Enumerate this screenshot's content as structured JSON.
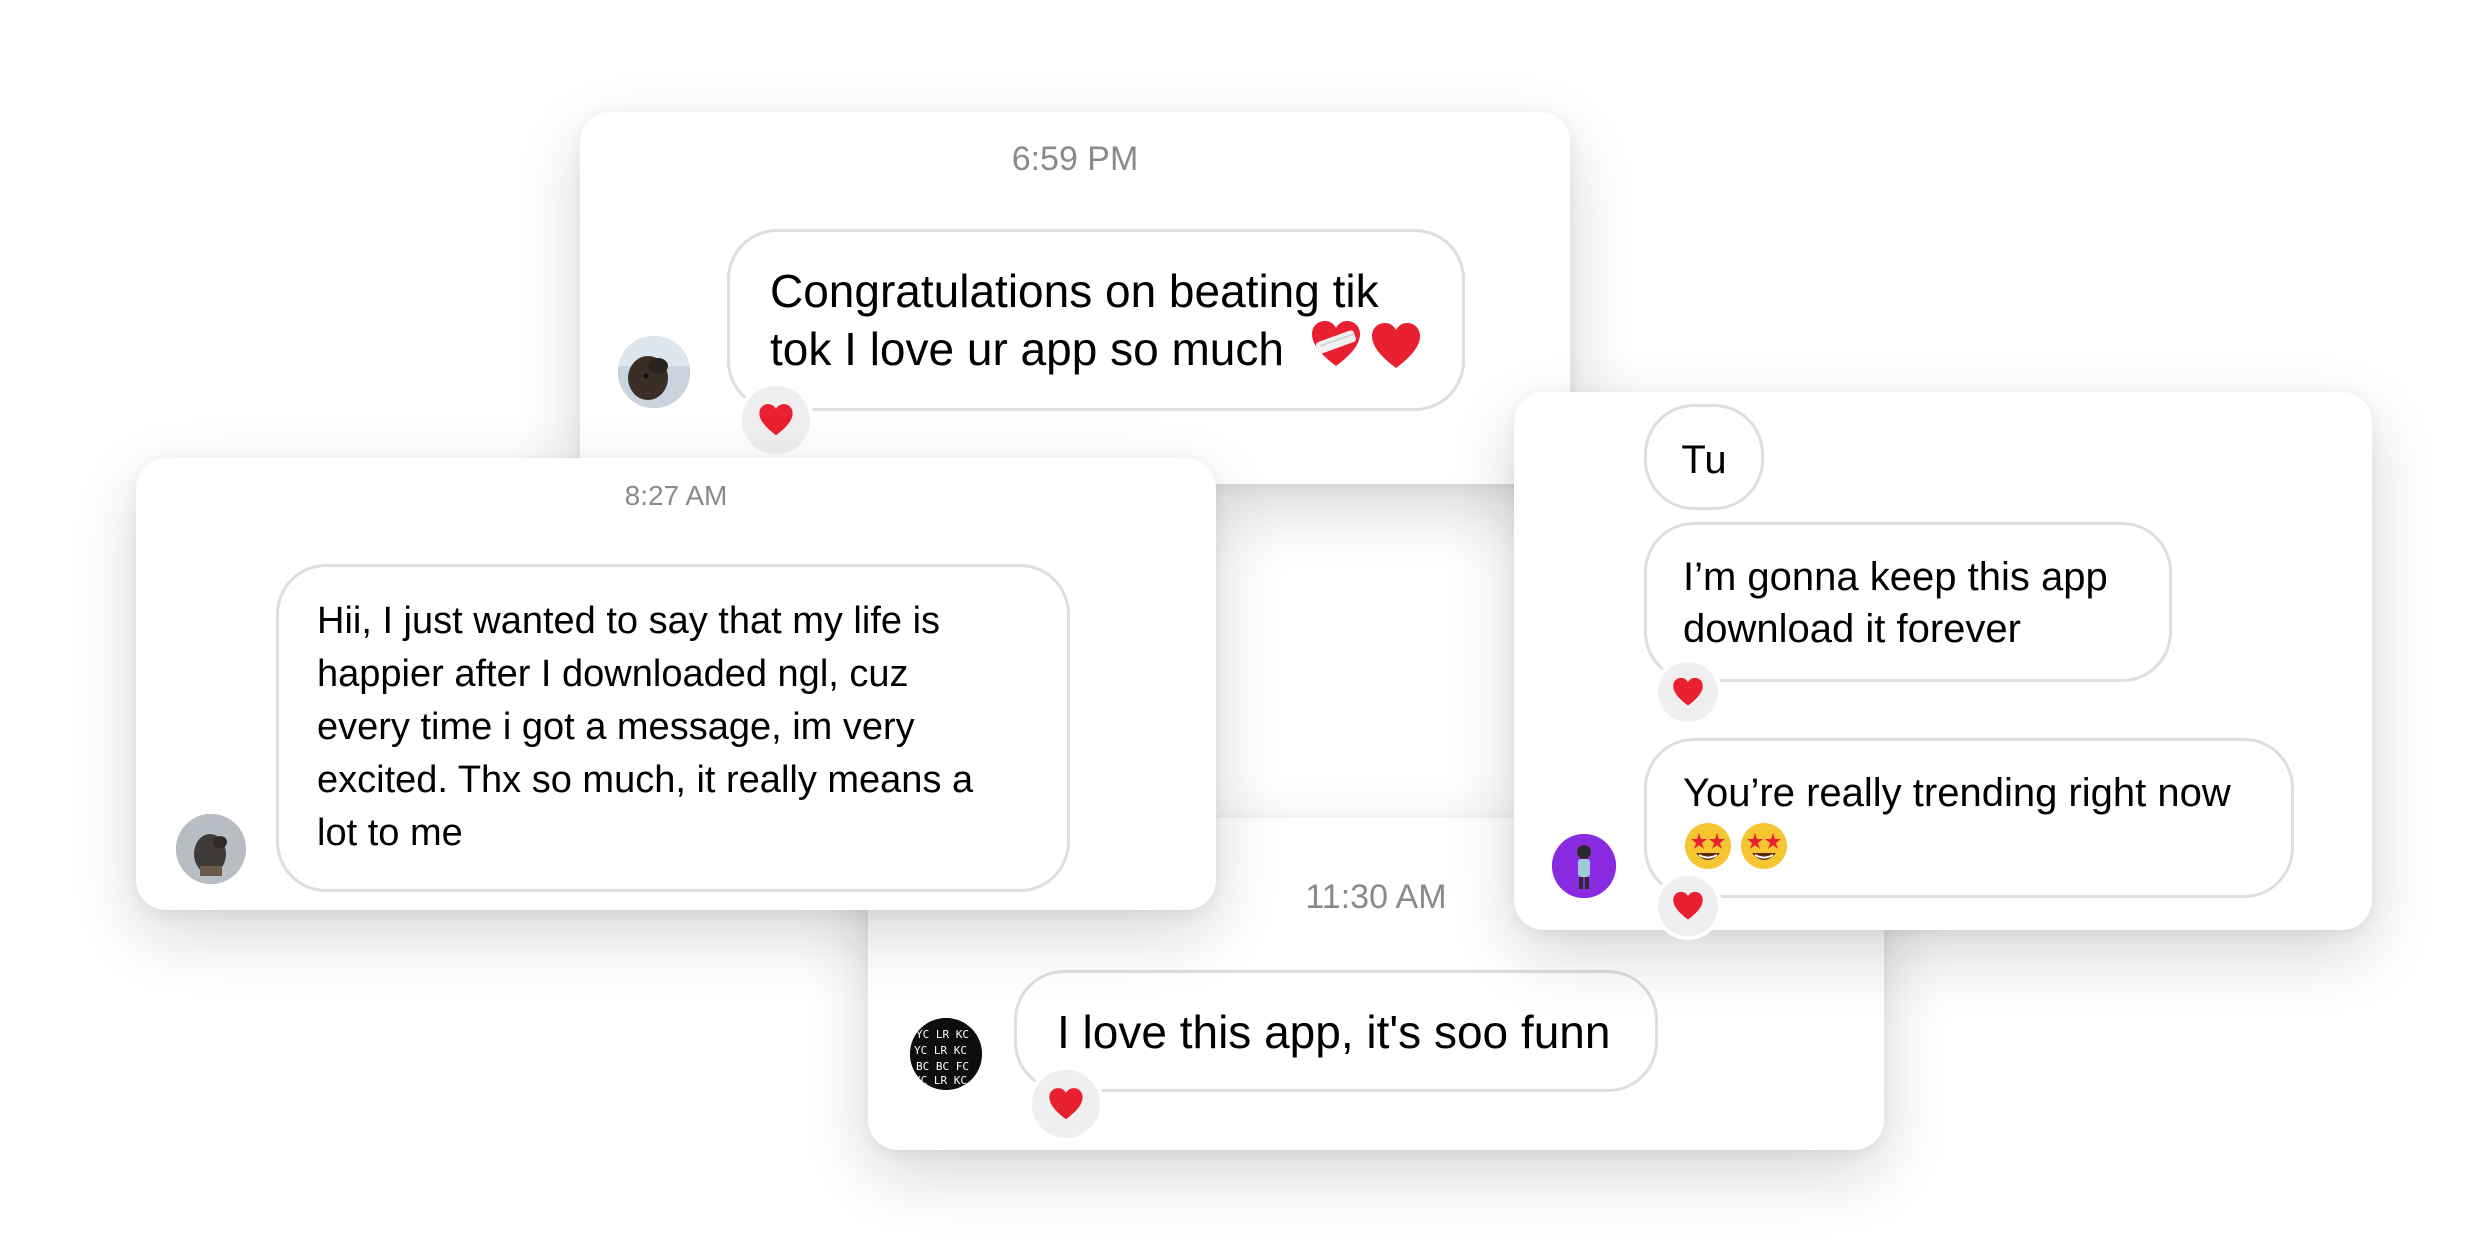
{
  "cards": {
    "top": {
      "timestamp": "6:59 PM",
      "message": "Congratulations on beating tik\ntok I love ur app so much",
      "reaction": "heart"
    },
    "left": {
      "timestamp": "8:27 AM",
      "message": "Hii, I just wanted to say that my life is\nhappier after I downloaded ngl, cuz\nevery time i got a message, im very\nexcited. Thx so much, it really means a\nlot to me"
    },
    "bottom": {
      "timestamp": "11:30 AM",
      "message": "I love this app, it's soo funn",
      "reaction": "heart"
    },
    "right": {
      "message_1": "Tu",
      "message_2": "I’m gonna keep this app\ndownload it forever",
      "message_3": "You’re really trending right now",
      "reaction": "heart"
    }
  },
  "colors": {
    "heart": "#e8202f",
    "bubble_border": "#dedede",
    "timestamp": "#8a8a8a",
    "avatar_purple": "#8a2be2"
  },
  "icons": {
    "reaction_icon": "heart-icon",
    "emoji_mending_heart": "mending-heart-icon",
    "emoji_star_struck": "star-struck-face-icon"
  }
}
